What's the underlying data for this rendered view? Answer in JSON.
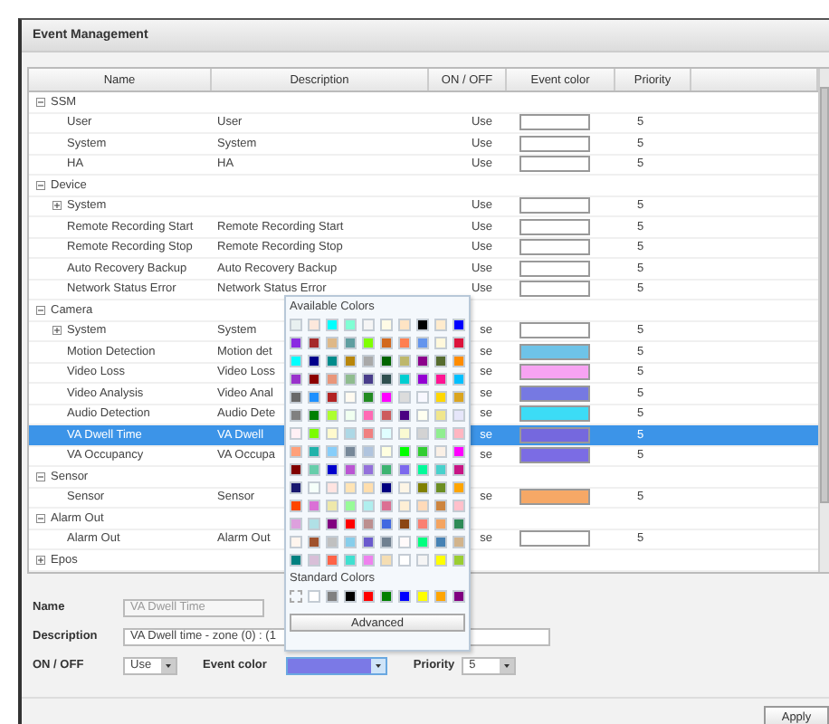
{
  "window": {
    "title": "Event Management"
  },
  "table": {
    "columns": [
      "Name",
      "Description",
      "ON / OFF",
      "Event color",
      "Priority"
    ],
    "groups": [
      {
        "name": "SSM",
        "expanded": true,
        "children": [
          {
            "kind": "item",
            "name": "User",
            "description": "User",
            "on_off": "Use",
            "color": "#ffffff",
            "priority": "5",
            "selected": false
          },
          {
            "kind": "item",
            "name": "System",
            "description": "System",
            "on_off": "Use",
            "color": "#ffffff",
            "priority": "5",
            "selected": false
          },
          {
            "kind": "item",
            "name": "HA",
            "description": "HA",
            "on_off": "Use",
            "color": "#ffffff",
            "priority": "5",
            "selected": false
          }
        ]
      },
      {
        "name": "Device",
        "expanded": true,
        "children": [
          {
            "kind": "folder",
            "expanded": false,
            "name": "System",
            "on_off": "Use",
            "color": "#ffffff",
            "priority": "5",
            "selected": false
          },
          {
            "kind": "item",
            "name": "Remote Recording Start",
            "description": "Remote Recording Start",
            "on_off": "Use",
            "color": "#ffffff",
            "priority": "5",
            "selected": false
          },
          {
            "kind": "item",
            "name": "Remote Recording Stop",
            "description": "Remote Recording Stop",
            "on_off": "Use",
            "color": "#ffffff",
            "priority": "5",
            "selected": false
          },
          {
            "kind": "item",
            "name": "Auto Recovery Backup",
            "description": "Auto Recovery Backup",
            "on_off": "Use",
            "color": "#ffffff",
            "priority": "5",
            "selected": false
          },
          {
            "kind": "item",
            "name": "Network Status Error",
            "description": "Network Status Error",
            "on_off": "Use",
            "color": "#ffffff",
            "priority": "5",
            "selected": false
          }
        ]
      },
      {
        "name": "Camera",
        "expanded": true,
        "children": [
          {
            "kind": "folder",
            "expanded": false,
            "name": "System",
            "description": "System",
            "on_off": "se",
            "color": "#ffffff",
            "priority": "5",
            "selected": false
          },
          {
            "kind": "item",
            "name": "Motion Detection",
            "description": "Motion det",
            "on_off": "se",
            "color": "#6ec3e8",
            "priority": "5",
            "selected": false
          },
          {
            "kind": "item",
            "name": "Video Loss",
            "description": "Video Loss",
            "on_off": "se",
            "color": "#f7a3f2",
            "priority": "5",
            "selected": false
          },
          {
            "kind": "item",
            "name": "Video Analysis",
            "description": "Video Anal",
            "on_off": "se",
            "color": "#7679e2",
            "priority": "5",
            "selected": false
          },
          {
            "kind": "item",
            "name": "Audio Detection",
            "description": "Audio Dete",
            "on_off": "se",
            "color": "#3cdcf6",
            "priority": "5",
            "selected": false
          },
          {
            "kind": "item",
            "name": "VA Dwell Time",
            "description": "VA Dwell",
            "on_off": "se",
            "color": "#7568de",
            "priority": "5",
            "selected": true
          },
          {
            "kind": "item",
            "name": "VA Occupancy",
            "description": "VA Occupa",
            "on_off": "se",
            "color": "#7b6ce4",
            "priority": "5",
            "selected": false
          }
        ]
      },
      {
        "name": "Sensor",
        "expanded": true,
        "children": [
          {
            "kind": "item",
            "name": "Sensor",
            "description": "Sensor",
            "on_off": "se",
            "color": "#f6a866",
            "priority": "5",
            "selected": false
          }
        ]
      },
      {
        "name": "Alarm Out",
        "expanded": true,
        "children": [
          {
            "kind": "item",
            "name": "Alarm Out",
            "description": "Alarm Out",
            "on_off": "se",
            "color": "#ffffff",
            "priority": "5",
            "selected": false
          }
        ]
      },
      {
        "name": "Epos",
        "expanded": false
      }
    ]
  },
  "color_picker": {
    "title": "Available Colors",
    "palette": [
      {
        "color": "#e8f0f0"
      },
      {
        "color": "#fde8dc"
      },
      {
        "color": "#00ffff"
      },
      {
        "color": "#7fffd4"
      },
      {
        "color": "#f5f5f5"
      },
      {
        "color": "#fffbe6"
      },
      {
        "color": "#ffe4c4"
      },
      {
        "color": "#000000"
      },
      {
        "color": "#ffebcd"
      },
      {
        "color": "#0000ff"
      },
      {
        "color": "#8a2be2"
      },
      {
        "color": "#a52a2a"
      },
      {
        "color": "#deb887"
      },
      {
        "color": "#5f9ea0"
      },
      {
        "color": "#7fff00"
      },
      {
        "color": "#d2691e"
      },
      {
        "color": "#ff7f50"
      },
      {
        "color": "#6495ed"
      },
      {
        "color": "#fff8dc"
      },
      {
        "color": "#dc143c"
      },
      {
        "color": "#00ffff"
      },
      {
        "color": "#00008b"
      },
      {
        "color": "#008b8b"
      },
      {
        "color": "#b8860b"
      },
      {
        "color": "#a9a9a9"
      },
      {
        "color": "#006400"
      },
      {
        "color": "#bdb76b"
      },
      {
        "color": "#8b008b"
      },
      {
        "color": "#556b2f"
      },
      {
        "color": "#ff8c00"
      },
      {
        "color": "#9932cc"
      },
      {
        "color": "#8b0000"
      },
      {
        "color": "#e9967a"
      },
      {
        "color": "#8fbc8f"
      },
      {
        "color": "#483d8b"
      },
      {
        "color": "#2f4f4f"
      },
      {
        "color": "#00ced1"
      },
      {
        "color": "#9400d3"
      },
      {
        "color": "#ff1493"
      },
      {
        "color": "#00bfff"
      },
      {
        "color": "#696969"
      },
      {
        "color": "#1e90ff"
      },
      {
        "color": "#b22222"
      },
      {
        "color": "#fffaf0"
      },
      {
        "color": "#228b22"
      },
      {
        "color": "#ff00ff"
      },
      {
        "color": "#dcdcdc"
      },
      {
        "color": "#f8f8ff"
      },
      {
        "color": "#ffd700"
      },
      {
        "color": "#daa520"
      },
      {
        "color": "#808080"
      },
      {
        "color": "#008000"
      },
      {
        "color": "#adff2f"
      },
      {
        "color": "#f0fff0"
      },
      {
        "color": "#ff69b4"
      },
      {
        "color": "#cd5c5c"
      },
      {
        "color": "#4b0082"
      },
      {
        "color": "#fffff0"
      },
      {
        "color": "#f0e68c"
      },
      {
        "color": "#e6e6fa"
      },
      {
        "color": "#fff0f5"
      },
      {
        "color": "#7cfc00"
      },
      {
        "color": "#fffacd"
      },
      {
        "color": "#add8e6"
      },
      {
        "color": "#f08080"
      },
      {
        "color": "#e0ffff"
      },
      {
        "color": "#fafad2"
      },
      {
        "color": "#d3d3d3"
      },
      {
        "color": "#90ee90"
      },
      {
        "color": "#ffb6c1"
      },
      {
        "color": "#ffa07a"
      },
      {
        "color": "#20b2aa"
      },
      {
        "color": "#87cefa"
      },
      {
        "color": "#778899"
      },
      {
        "color": "#b0c4de"
      },
      {
        "color": "#ffffe0"
      },
      {
        "color": "#00ff00"
      },
      {
        "color": "#32cd32"
      },
      {
        "color": "#faf0e6"
      },
      {
        "color": "#ff00ff"
      },
      {
        "color": "#800000"
      },
      {
        "color": "#66cdaa"
      },
      {
        "color": "#0000cd"
      },
      {
        "color": "#ba55d3"
      },
      {
        "color": "#9370db"
      },
      {
        "color": "#3cb371"
      },
      {
        "color": "#7b68ee"
      },
      {
        "color": "#00fa9a"
      },
      {
        "color": "#48d1cc"
      },
      {
        "color": "#c71585"
      },
      {
        "color": "#191970"
      },
      {
        "color": "#f5fffa"
      },
      {
        "color": "#ffe4e1"
      },
      {
        "color": "#ffe4b5"
      },
      {
        "color": "#ffdead"
      },
      {
        "color": "#000080"
      },
      {
        "color": "#fdf5e6"
      },
      {
        "color": "#808000"
      },
      {
        "color": "#6b8e23"
      },
      {
        "color": "#ffa500"
      },
      {
        "color": "#ff4500"
      },
      {
        "color": "#da70d6"
      },
      {
        "color": "#eee8aa"
      },
      {
        "color": "#98fb98"
      },
      {
        "color": "#afeeee"
      },
      {
        "color": "#db7093"
      },
      {
        "color": "#ffefd5"
      },
      {
        "color": "#ffdab9"
      },
      {
        "color": "#cd853f"
      },
      {
        "color": "#ffc0cb"
      },
      {
        "color": "#dda0dd"
      },
      {
        "color": "#b0e0e6"
      },
      {
        "color": "#800080"
      },
      {
        "color": "#ff0000"
      },
      {
        "color": "#bc8f8f"
      },
      {
        "color": "#4169e1"
      },
      {
        "color": "#8b4513"
      },
      {
        "color": "#fa8072"
      },
      {
        "color": "#f4a460"
      },
      {
        "color": "#2e8b57"
      },
      {
        "color": "#fff5ee"
      },
      {
        "color": "#a0522d"
      },
      {
        "color": "#c0c0c0"
      },
      {
        "color": "#87ceeb"
      },
      {
        "color": "#6a5acd"
      },
      {
        "color": "#708090"
      },
      {
        "color": "#fffafa"
      },
      {
        "color": "#00ff7f"
      },
      {
        "color": "#4682b4"
      },
      {
        "color": "#d2b48c"
      },
      {
        "color": "#008080"
      },
      {
        "color": "#d8bfd8"
      },
      {
        "color": "#ff6347"
      },
      {
        "color": "#40e0d0"
      },
      {
        "color": "#ee82ee"
      },
      {
        "color": "#f5deb3"
      },
      {
        "color": "#ffffff"
      },
      {
        "color": "#f5f5f5"
      },
      {
        "color": "#ffff00"
      },
      {
        "color": "#9acd32"
      }
    ],
    "standard_title": "Standard Colors",
    "standard": [
      {
        "kind": "none"
      },
      {
        "kind": "swatch",
        "color": "#ffffff"
      },
      {
        "kind": "swatch",
        "color": "#808080"
      },
      {
        "kind": "swatch",
        "color": "#000000"
      },
      {
        "kind": "swatch",
        "color": "#ff0000"
      },
      {
        "kind": "swatch",
        "color": "#008000"
      },
      {
        "kind": "swatch",
        "color": "#0000ff"
      },
      {
        "kind": "swatch",
        "color": "#ffff00"
      },
      {
        "kind": "swatch",
        "color": "#ffa500"
      },
      {
        "kind": "swatch",
        "color": "#800080"
      }
    ],
    "button": "Advanced"
  },
  "form": {
    "name": {
      "label": "Name",
      "value": "VA Dwell Time",
      "disabled": true
    },
    "description": {
      "label": "Description",
      "value": "VA Dwell time - zone (0) : (1"
    },
    "on_off": {
      "label": "ON / OFF",
      "value": "Use"
    },
    "event_color": {
      "label": "Event color",
      "color": "#7b79e6"
    },
    "priority": {
      "label": "Priority",
      "value": "5"
    }
  },
  "buttons": [
    "Apply"
  ]
}
